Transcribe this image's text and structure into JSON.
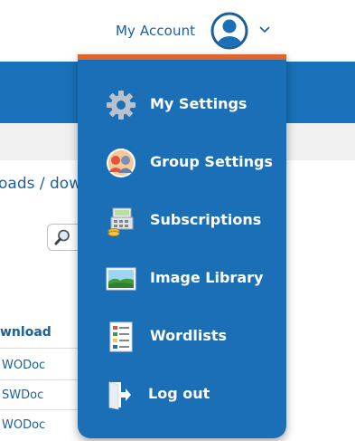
{
  "header": {
    "account_label": "My Account",
    "avatar_icon": "user-avatar-icon",
    "chevron_icon": "chevron-down-icon"
  },
  "content": {
    "breadcrumb": "oads / down",
    "search_icon": "magnifier-icon",
    "table": {
      "column_header": "wnload",
      "rows": [
        "WODoc",
        "SWDoc",
        "WODoc"
      ]
    }
  },
  "account_menu": {
    "accent_color": "#e0652c",
    "background_color": "#1a6fb6",
    "items": [
      {
        "label": "My Settings",
        "icon": "gear-icon"
      },
      {
        "label": "Group Settings",
        "icon": "group-avatar-icon"
      },
      {
        "label": "Subscriptions",
        "icon": "cash-register-icon"
      },
      {
        "label": "Image Library",
        "icon": "landscape-image-icon"
      },
      {
        "label": "Wordlists",
        "icon": "wordlist-icon"
      },
      {
        "label": "Log out",
        "icon": "exit-door-icon"
      }
    ]
  }
}
